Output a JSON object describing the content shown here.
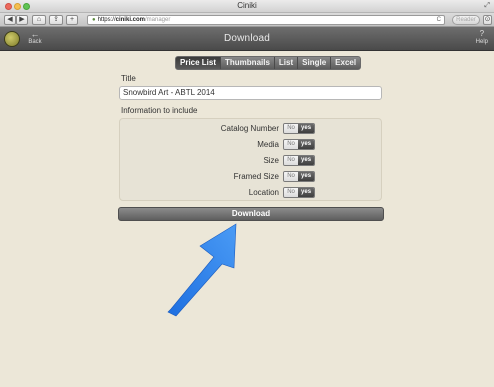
{
  "window": {
    "title": "Ciniki"
  },
  "browser": {
    "url_prefix": "https://",
    "url_host": "ciniki.com",
    "url_path": "/manager",
    "reader_label": "Reader",
    "back_label": "◀",
    "forward_label": "▶",
    "home_label": "⌂",
    "share_label": "⇪",
    "add_label": "+",
    "reload_label": "C"
  },
  "appbar": {
    "back_label": "Back",
    "title": "Download",
    "help_label": "Help",
    "help_icon": "?"
  },
  "formats": [
    {
      "label": "Price List",
      "active": true
    },
    {
      "label": "Thumbnails",
      "active": false
    },
    {
      "label": "List",
      "active": false
    },
    {
      "label": "Single",
      "active": false
    },
    {
      "label": "Excel",
      "active": false
    }
  ],
  "form": {
    "title_label": "Title",
    "title_value": "Snowbird Art - ABTL 2014",
    "include_label": "Information to include",
    "options": [
      {
        "label": "Catalog Number",
        "no": "No",
        "yes": "yes",
        "selected": "yes"
      },
      {
        "label": "Media",
        "no": "No",
        "yes": "yes",
        "selected": "yes"
      },
      {
        "label": "Size",
        "no": "No",
        "yes": "yes",
        "selected": "yes"
      },
      {
        "label": "Framed Size",
        "no": "No",
        "yes": "yes",
        "selected": "yes"
      },
      {
        "label": "Location",
        "no": "No",
        "yes": "yes",
        "selected": "yes"
      }
    ],
    "download_label": "Download"
  },
  "annotation": {
    "arrow_color": "#2f7fe8"
  }
}
